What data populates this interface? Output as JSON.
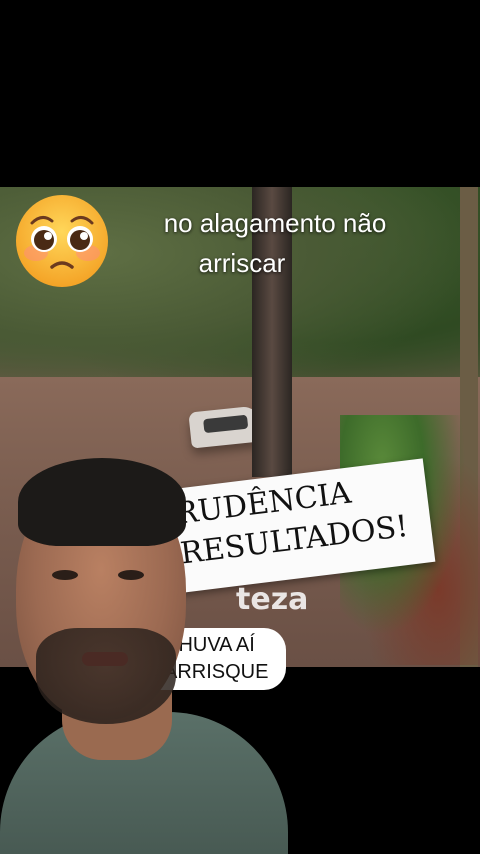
{
  "caption": {
    "line1": "no alagamento não",
    "line2": "arriscar"
  },
  "emoji": {
    "name": "pleading-face-emoji",
    "color": "#f7b733"
  },
  "sign": {
    "line1": "RUDÊNCIA",
    "line2": "RESULTADOS!"
  },
  "watermark": "teza",
  "speech_bubble": {
    "line1": "CHUVA AÍ",
    "line2": "ARRISQUE"
  }
}
